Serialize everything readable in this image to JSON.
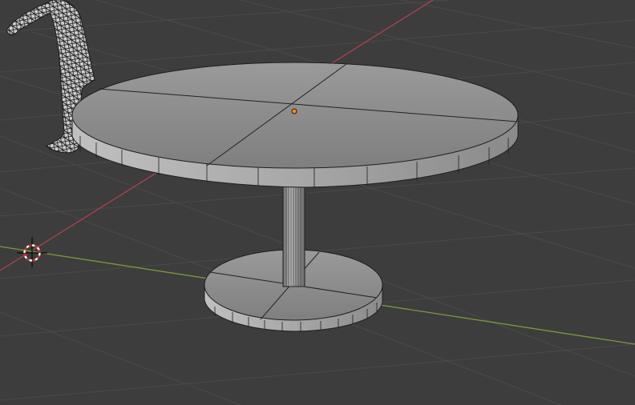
{
  "app": {
    "view": "3d-viewport",
    "shading": "solid"
  },
  "colors": {
    "background": "#3d3d3d",
    "grid": "#4a4a4a",
    "x_axis": "#b0404f",
    "y_axis": "#7a9a3a",
    "mesh_face": "#8f8f8f",
    "mesh_side": "#a6a6a6",
    "mesh_edge": "#1e1e1e",
    "origin": "#ff8c1a",
    "cursor": "#ffffff",
    "cursor_accent": "#d03030"
  },
  "icons": {
    "cursor": "3d-cursor-icon",
    "origin": "object-origin-icon"
  },
  "scene": {
    "objects": [
      "table",
      "human-figure"
    ]
  }
}
